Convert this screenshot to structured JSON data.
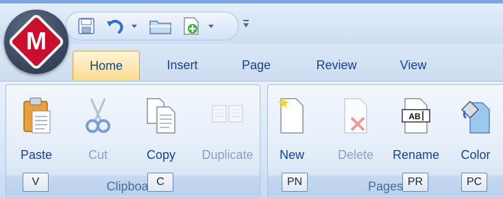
{
  "tabs": [
    {
      "label": "Home",
      "active": true
    },
    {
      "label": "Insert",
      "active": false
    },
    {
      "label": "Page",
      "active": false
    },
    {
      "label": "Review",
      "active": false
    },
    {
      "label": "View",
      "active": false
    }
  ],
  "quick_access": [
    "save-icon",
    "undo-icon",
    "open-folder-icon",
    "new-document-icon",
    "customize-icon"
  ],
  "groups": {
    "clipboard": {
      "label": "Clipboard",
      "buttons": {
        "paste": {
          "label": "Paste",
          "icon": "clipboard-icon",
          "enabled": true
        },
        "cut": {
          "label": "Cut",
          "icon": "scissors-icon",
          "enabled": false
        },
        "copy": {
          "label": "Copy",
          "icon": "copy-icon",
          "enabled": true
        },
        "duplicate": {
          "label": "Duplicate",
          "icon": "duplicate-icon",
          "enabled": false
        }
      },
      "keytips": {
        "paste": "V",
        "copy": "C"
      }
    },
    "pages": {
      "label": "Pages",
      "buttons": {
        "new": {
          "label": "New",
          "icon": "new-page-icon",
          "enabled": true
        },
        "delete": {
          "label": "Delete",
          "icon": "delete-page-icon",
          "enabled": false
        },
        "rename": {
          "label": "Rename",
          "icon": "rename-icon",
          "enabled": true
        },
        "color": {
          "label": "Color",
          "icon": "paint-bucket-icon",
          "enabled": true
        }
      },
      "keytips": {
        "new": "PN",
        "rename": "PR",
        "color": "PC"
      },
      "logo_letter": "M"
    }
  },
  "colors": {
    "accent": "#15428b",
    "logo_red": "#c8102e",
    "active_tab": "#fde9b5"
  }
}
